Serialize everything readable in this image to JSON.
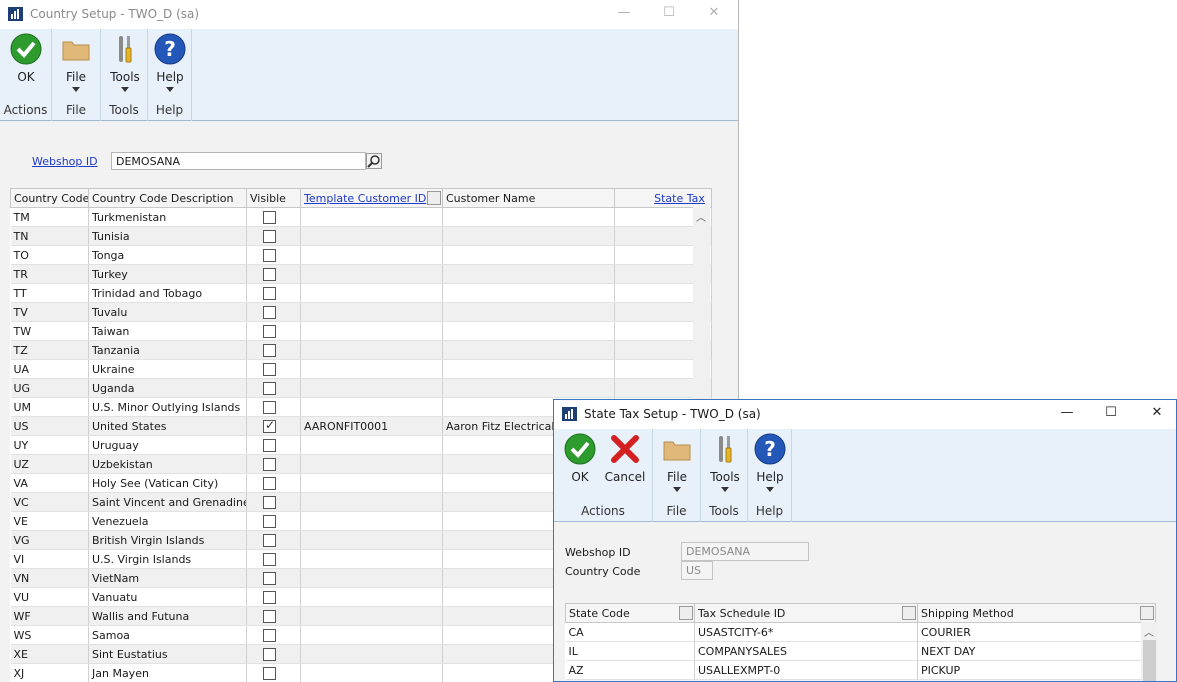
{
  "country_setup": {
    "title": "Country Setup  -  TWO_D (sa)",
    "ribbon": {
      "ok": "OK",
      "file": "File",
      "tools": "Tools",
      "help": "Help",
      "groups": {
        "actions": "Actions",
        "file": "File",
        "tools": "Tools",
        "help": "Help"
      }
    },
    "webshop_id_label": "Webshop ID",
    "webshop_id_value": "DEMOSANA",
    "columns": [
      "Country Code",
      "Country Code Description",
      "Visible",
      "Template Customer ID",
      "Customer Name",
      "State Tax"
    ],
    "rows": [
      {
        "code": "TM",
        "desc": "Turkmenistan",
        "visible": false,
        "template": "",
        "customer": ""
      },
      {
        "code": "TN",
        "desc": "Tunisia",
        "visible": false,
        "template": "",
        "customer": ""
      },
      {
        "code": "TO",
        "desc": "Tonga",
        "visible": false,
        "template": "",
        "customer": ""
      },
      {
        "code": "TR",
        "desc": "Turkey",
        "visible": false,
        "template": "",
        "customer": ""
      },
      {
        "code": "TT",
        "desc": "Trinidad and Tobago",
        "visible": false,
        "template": "",
        "customer": ""
      },
      {
        "code": "TV",
        "desc": "Tuvalu",
        "visible": false,
        "template": "",
        "customer": ""
      },
      {
        "code": "TW",
        "desc": "Taiwan",
        "visible": false,
        "template": "",
        "customer": ""
      },
      {
        "code": "TZ",
        "desc": "Tanzania",
        "visible": false,
        "template": "",
        "customer": ""
      },
      {
        "code": "UA",
        "desc": "Ukraine",
        "visible": false,
        "template": "",
        "customer": ""
      },
      {
        "code": "UG",
        "desc": "Uganda",
        "visible": false,
        "template": "",
        "customer": ""
      },
      {
        "code": "UM",
        "desc": "U.S. Minor Outlying Islands",
        "visible": false,
        "template": "",
        "customer": ""
      },
      {
        "code": "US",
        "desc": "United States",
        "visible": true,
        "template": "AARONFIT0001",
        "customer": "Aaron Fitz Electrical"
      },
      {
        "code": "UY",
        "desc": "Uruguay",
        "visible": false,
        "template": "",
        "customer": ""
      },
      {
        "code": "UZ",
        "desc": "Uzbekistan",
        "visible": false,
        "template": "",
        "customer": ""
      },
      {
        "code": "VA",
        "desc": "Holy See (Vatican City)",
        "visible": false,
        "template": "",
        "customer": ""
      },
      {
        "code": "VC",
        "desc": "Saint Vincent and Grenadines",
        "visible": false,
        "template": "",
        "customer": ""
      },
      {
        "code": "VE",
        "desc": "Venezuela",
        "visible": false,
        "template": "",
        "customer": ""
      },
      {
        "code": "VG",
        "desc": "British Virgin Islands",
        "visible": false,
        "template": "",
        "customer": ""
      },
      {
        "code": "VI",
        "desc": "U.S. Virgin Islands",
        "visible": false,
        "template": "",
        "customer": ""
      },
      {
        "code": "VN",
        "desc": "VietNam",
        "visible": false,
        "template": "",
        "customer": ""
      },
      {
        "code": "VU",
        "desc": "Vanuatu",
        "visible": false,
        "template": "",
        "customer": ""
      },
      {
        "code": "WF",
        "desc": "Wallis and Futuna",
        "visible": false,
        "template": "",
        "customer": ""
      },
      {
        "code": "WS",
        "desc": "Samoa",
        "visible": false,
        "template": "",
        "customer": ""
      },
      {
        "code": "XE",
        "desc": "Sint Eustatius",
        "visible": false,
        "template": "",
        "customer": ""
      },
      {
        "code": "XJ",
        "desc": "Jan Mayen",
        "visible": false,
        "template": "",
        "customer": ""
      }
    ]
  },
  "state_tax_setup": {
    "title": "State Tax Setup  -  TWO_D (sa)",
    "ribbon": {
      "ok": "OK",
      "cancel": "Cancel",
      "file": "File",
      "tools": "Tools",
      "help": "Help",
      "groups": {
        "actions": "Actions",
        "file": "File",
        "tools": "Tools",
        "help": "Help"
      }
    },
    "webshop_id_label": "Webshop ID",
    "webshop_id_value": "DEMOSANA",
    "country_code_label": "Country Code",
    "country_code_value": "US",
    "columns": [
      "State Code",
      "Tax Schedule ID",
      "Shipping Method"
    ],
    "rows": [
      {
        "state": "CA",
        "schedule": "USASTCITY-6*",
        "shipping": "COURIER"
      },
      {
        "state": "IL",
        "schedule": "COMPANYSALES",
        "shipping": "NEXT DAY"
      },
      {
        "state": "AZ",
        "schedule": "USALLEXMPT-0",
        "shipping": "PICKUP"
      }
    ]
  },
  "icons": {
    "ok": "check-circle-icon",
    "cancel": "red-x-icon",
    "file": "folder-icon",
    "tools": "wrench-screwdriver-icon",
    "help": "question-circle-icon",
    "lookup": "magnifier-icon"
  },
  "colors": {
    "link": "#1f39c8",
    "ribbon": "#e8f1fa",
    "ok_green": "#2e9b2e",
    "help_blue": "#2358b8",
    "cancel_red": "#d42020"
  }
}
